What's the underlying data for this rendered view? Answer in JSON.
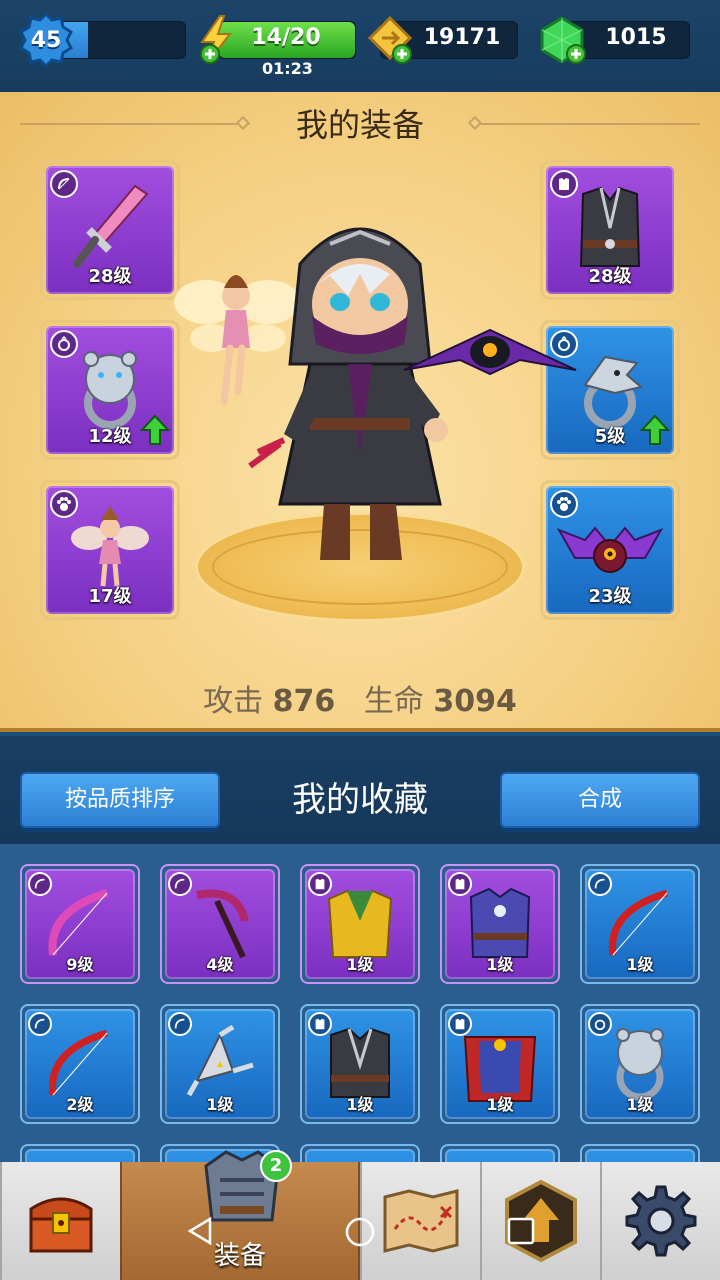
{
  "topbar": {
    "level": "45",
    "level_progress": 0.3,
    "energy": "14/20",
    "energy_timer": "01:23",
    "gold": "19171",
    "gems": "1015"
  },
  "equipment": {
    "title": "我的装备",
    "left_slots": [
      {
        "type_icon": "bow-icon",
        "item_icon": "sword-icon",
        "level": "28级",
        "rarity": "purple"
      },
      {
        "type_icon": "ring-icon",
        "item_icon": "bear-ring-icon",
        "level": "12级",
        "rarity": "purple",
        "upgrade": true
      },
      {
        "type_icon": "pet-icon",
        "item_icon": "fairy-icon",
        "level": "17级",
        "rarity": "purple"
      }
    ],
    "right_slots": [
      {
        "type_icon": "armor-icon",
        "item_icon": "robe-icon",
        "level": "28级",
        "rarity": "purple"
      },
      {
        "type_icon": "ring-icon",
        "item_icon": "eagle-ring-icon",
        "level": "5级",
        "rarity": "blue",
        "upgrade": true
      },
      {
        "type_icon": "pet-icon",
        "item_icon": "bat-icon",
        "level": "23级",
        "rarity": "blue"
      }
    ],
    "stats": {
      "attack_label": "攻击",
      "attack_value": "876",
      "hp_label": "生命",
      "hp_value": "3094"
    }
  },
  "collection": {
    "sort_button": "按品质排序",
    "title": "我的收藏",
    "merge_button": "合成",
    "items": [
      {
        "type_icon": "bow-icon",
        "item_icon": "pink-bow-icon",
        "level": "9级",
        "rarity": "purple"
      },
      {
        "type_icon": "bow-icon",
        "item_icon": "scythe-icon",
        "level": "4级",
        "rarity": "purple"
      },
      {
        "type_icon": "armor-icon",
        "item_icon": "gold-armor-icon",
        "level": "1级",
        "rarity": "purple"
      },
      {
        "type_icon": "armor-icon",
        "item_icon": "mage-robe-icon",
        "level": "1级",
        "rarity": "purple"
      },
      {
        "type_icon": "bow-icon",
        "item_icon": "red-bow-icon",
        "level": "1级",
        "rarity": "blue"
      },
      {
        "type_icon": "bow-icon",
        "item_icon": "red-bow-icon",
        "level": "2级",
        "rarity": "blue"
      },
      {
        "type_icon": "bow-icon",
        "item_icon": "shuriken-icon",
        "level": "1级",
        "rarity": "blue"
      },
      {
        "type_icon": "armor-icon",
        "item_icon": "robe-icon",
        "level": "1级",
        "rarity": "blue"
      },
      {
        "type_icon": "armor-icon",
        "item_icon": "red-cape-armor-icon",
        "level": "1级",
        "rarity": "blue"
      },
      {
        "type_icon": "ring-icon",
        "item_icon": "bear-ring-icon",
        "level": "1级",
        "rarity": "blue"
      }
    ]
  },
  "nav": {
    "items": [
      {
        "name": "chest-icon"
      },
      {
        "name": "armor-icon",
        "label": "装备",
        "badge": "2"
      },
      {
        "name": "map-icon"
      },
      {
        "name": "upgrade-icon"
      },
      {
        "name": "gear-icon"
      }
    ]
  },
  "colors": {
    "purple_rarity": "#8c3fd2",
    "blue_rarity": "#237ad6",
    "panel_gold": "#f5cf82",
    "nav_active": "#b57a40"
  }
}
